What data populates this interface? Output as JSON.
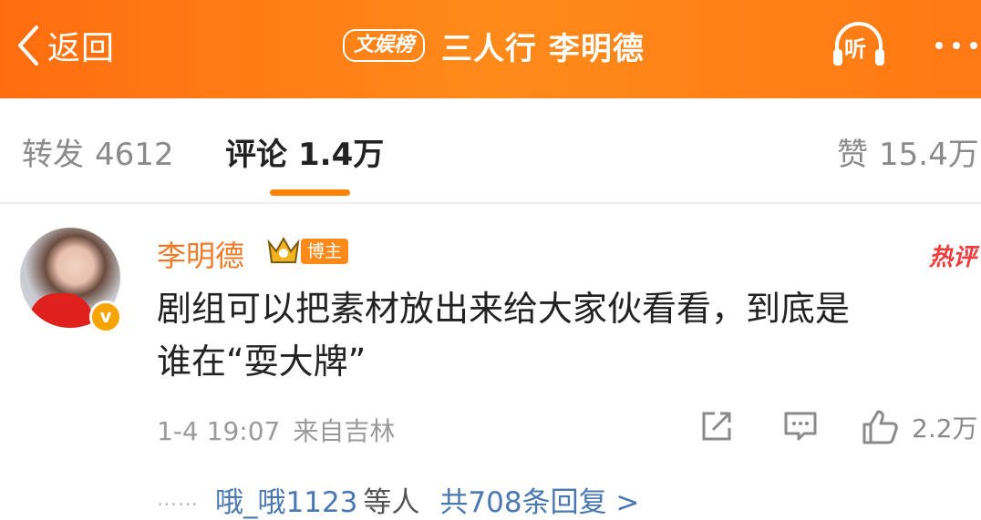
{
  "header": {
    "back_label": "返回",
    "badge": "文娱榜",
    "title": "三人行 李明德",
    "listen_label": "听"
  },
  "tabs": {
    "repost": {
      "label": "转发",
      "count": "4612"
    },
    "comment": {
      "label": "评论",
      "count": "1.4万"
    },
    "like": {
      "label": "赞",
      "count": "15.4万"
    }
  },
  "comment": {
    "author": "李明德",
    "author_tag": "博主",
    "hot_tag": "热评",
    "verified_mark": "v",
    "text_line1": "剧组可以把素材放出来给大家伙看看，到底是",
    "text_line2": "谁在“耍大牌”",
    "time": "1-4 19:07",
    "source": "来自吉林",
    "like_count": "2.2万"
  },
  "replies": {
    "dots": "……",
    "user": "哦_哦1123",
    "suffix": "等人",
    "total": "共708条回复 >"
  },
  "colors": {
    "header_orange": "#ff7914",
    "accent": "#ff8200",
    "author_name": "#ef7a27",
    "link_blue": "#4a78b2",
    "hot_red": "#f03c3c"
  },
  "icons": {
    "back": "chevron-left-icon",
    "listen": "headphones-icon",
    "more": "more-dots-icon",
    "share": "share-icon",
    "reply": "comment-icon",
    "like": "thumbs-up-icon",
    "crown": "crown-icon",
    "verified": "verified-badge-icon"
  }
}
